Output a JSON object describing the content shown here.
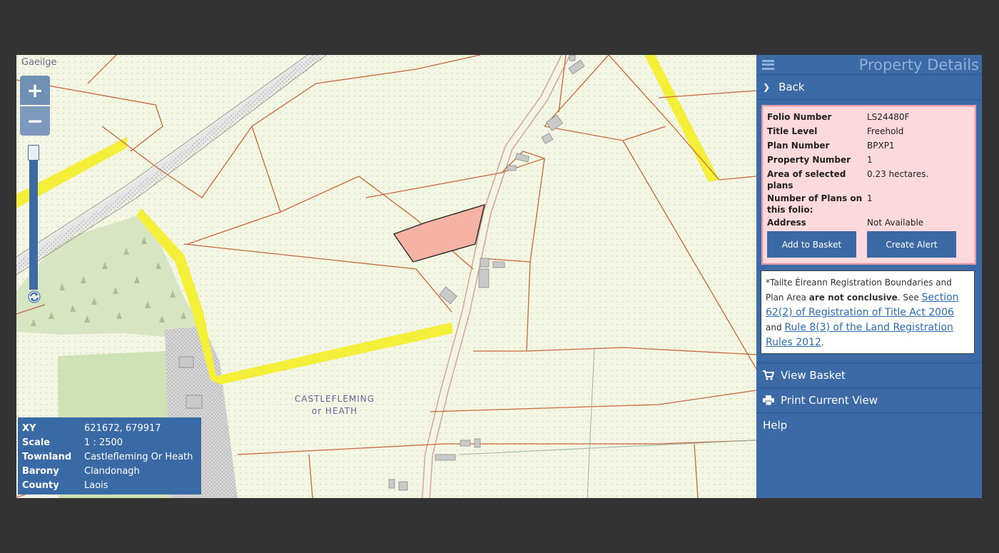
{
  "map": {
    "language_link": "Gaeilge",
    "zoom_in_label": "+",
    "zoom_out_label": "−",
    "townland_line1": "CASTLEFLEMING",
    "townland_line2": "or HEATH",
    "info": {
      "xy_label": "XY",
      "xy_value": "621672, 679917",
      "scale_label": "Scale",
      "scale_value": "1 : 2500",
      "townland_label": "Townland",
      "townland_value": "Castlefleming Or Heath",
      "barony_label": "Barony",
      "barony_value": "Clandonagh",
      "county_label": "County",
      "county_value": "Laois"
    },
    "colors": {
      "background": "#f4f6e4",
      "boundary": "#c8673a",
      "road": "#f4ef39",
      "selected_plot": "#f6b2a4",
      "woodland": "#d7e5c2",
      "field_green": "#cfe2b6"
    }
  },
  "sidebar": {
    "title": "Property Details",
    "back_label": "Back",
    "details": {
      "folio_label": "Folio Number",
      "folio_value": "LS24480F",
      "title_level_label": "Title Level",
      "title_level_value": "Freehold",
      "plan_label": "Plan Number",
      "plan_value": "BPXP1",
      "property_label": "Property Number",
      "property_value": "1",
      "area_label": "Area of selected plans",
      "area_value": "0.23 hectares.",
      "num_plans_label": "Number of Plans on this folio:",
      "num_plans_value": "1",
      "address_label": "Address",
      "address_value": "Not Available"
    },
    "add_to_basket": "Add to Basket",
    "create_alert": "Create Alert",
    "notice": {
      "text1": "*Tailte Éireann Registration Boundaries and Plan Area ",
      "bold": "are not conclusive",
      "text2": ". See ",
      "link1": "Section 62(2) of Registration of Title Act 2006",
      "text3": " and ",
      "link2": "Rule 8(3) of the Land Registration Rules 2012",
      "text4": "."
    },
    "menu": {
      "view_basket": "View Basket",
      "print_view": "Print Current View",
      "help": "Help"
    },
    "colors": {
      "panel": "#3b6aa6",
      "details_bg": "#fbd9dc",
      "details_border": "#e79aa3"
    }
  }
}
